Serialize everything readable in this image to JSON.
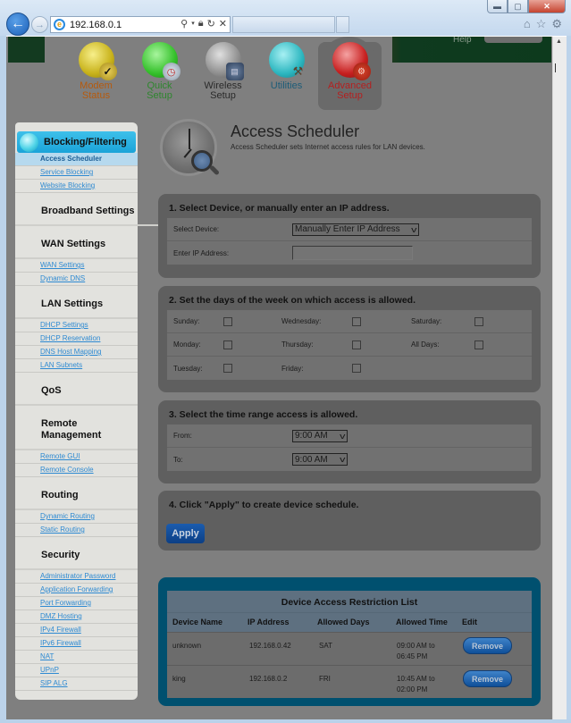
{
  "browser": {
    "address": "192.168.0.1",
    "back_icon": "arrow-left-icon",
    "forward_icon": "arrow-right-icon",
    "address_icons": [
      "search-icon",
      "dropdown-icon",
      "lock-icon",
      "refresh-icon",
      "stop-icon"
    ],
    "toolbar_icons": [
      "home-icon",
      "star-icon",
      "gear-icon"
    ],
    "window_buttons": [
      "minimize",
      "maximize",
      "close"
    ]
  },
  "header": {
    "help_label": "Help"
  },
  "topnav": [
    {
      "label1": "Modem",
      "label2": "Status",
      "color": "#c4620c"
    },
    {
      "label1": "Quick",
      "label2": "Setup",
      "color": "#2f8a2f"
    },
    {
      "label1": "Wireless",
      "label2": "Setup",
      "color": "#2d2d2d"
    },
    {
      "label1": "Utilities",
      "label2": "",
      "color": "#1e5f7a"
    },
    {
      "label1": "Advanced",
      "label2": "Setup",
      "color": "#b81f1f",
      "active": true
    }
  ],
  "sidebar": {
    "head": "Blocking/Filtering",
    "blocking": [
      {
        "label": "Access Scheduler",
        "active": true
      },
      {
        "label": "Service Blocking"
      },
      {
        "label": "Website Blocking"
      }
    ],
    "broadband_title": "Broadband Settings",
    "wan_title": "WAN Settings",
    "wan": [
      {
        "label": "WAN Settings"
      },
      {
        "label": "Dynamic DNS"
      }
    ],
    "lan_title": "LAN Settings",
    "lan": [
      {
        "label": "DHCP Settings"
      },
      {
        "label": "DHCP Reservation"
      },
      {
        "label": "DNS Host Mapping"
      },
      {
        "label": "LAN Subnets"
      }
    ],
    "qos_title": "QoS",
    "remote_title": "Remote Management",
    "remote": [
      {
        "label": "Remote GUI"
      },
      {
        "label": "Remote Console"
      }
    ],
    "routing_title": "Routing",
    "routing": [
      {
        "label": "Dynamic Routing"
      },
      {
        "label": "Static Routing"
      }
    ],
    "security_title": "Security",
    "security": [
      {
        "label": "Administrator Password"
      },
      {
        "label": "Application Forwarding"
      },
      {
        "label": "Port Forwarding"
      },
      {
        "label": "DMZ Hosting"
      },
      {
        "label": "IPv4 Firewall"
      },
      {
        "label": "IPv6 Firewall"
      },
      {
        "label": "NAT"
      },
      {
        "label": "UPnP"
      },
      {
        "label": "SIP ALG"
      }
    ]
  },
  "page": {
    "title": "Access Scheduler",
    "description": "Access Scheduler sets Internet access rules for LAN devices."
  },
  "step1": {
    "title": "1. Select Device, or manually enter an IP address.",
    "select_label": "Select Device:",
    "select_value": "Manually Enter IP Address",
    "ip_label": "Enter IP Address:",
    "ip_value": ""
  },
  "step2": {
    "title": "2. Set the days of the week on which access is allowed.",
    "days": {
      "sunday": {
        "label": "Sunday:",
        "checked": false
      },
      "monday": {
        "label": "Monday:",
        "checked": false
      },
      "tuesday": {
        "label": "Tuesday:",
        "checked": false
      },
      "wednesday": {
        "label": "Wednesday:",
        "checked": false
      },
      "thursday": {
        "label": "Thursday:",
        "checked": false
      },
      "friday": {
        "label": "Friday:",
        "checked": false
      },
      "saturday": {
        "label": "Saturday:",
        "checked": false
      },
      "all": {
        "label": "All Days:",
        "checked": false
      }
    }
  },
  "step3": {
    "title": "3. Select the time range access is allowed.",
    "from_label": "From:",
    "from_value": "9:00 AM",
    "to_label": "To:",
    "to_value": "9:00 AM"
  },
  "step4": {
    "title": "4. Click \"Apply\" to create device schedule.",
    "apply_label": "Apply"
  },
  "restriction_list": {
    "title": "Device Access Restriction List",
    "columns": [
      "Device Name",
      "IP Address",
      "Allowed Days",
      "Allowed Time",
      "Edit"
    ],
    "rows": [
      {
        "device": "unknown",
        "ip": "192.168.0.42",
        "days": "SAT",
        "time1": "09:00 AM to",
        "time2": "06:45 PM",
        "action": "Remove"
      },
      {
        "device": "king",
        "ip": "192.168.0.2",
        "days": "FRI",
        "time1": "10:45 AM to",
        "time2": "02:00 PM",
        "action": "Remove"
      }
    ]
  }
}
